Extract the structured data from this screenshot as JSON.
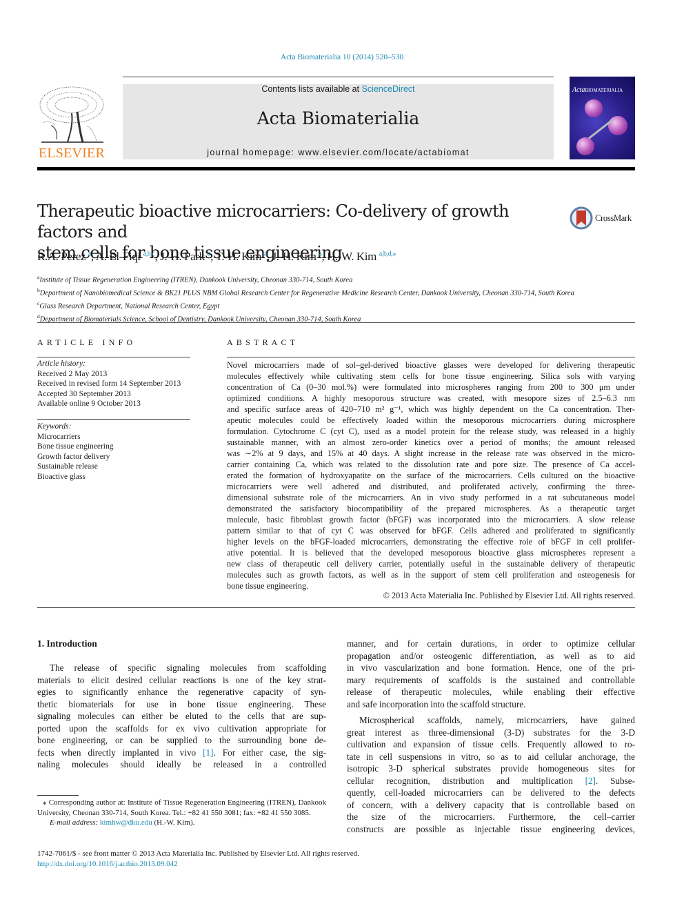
{
  "header": {
    "journal_reference": "Acta Biomaterialia 10 (2014) 520–530",
    "publisher_logo_text": "ELSEVIER",
    "contents_prefix": "Contents lists available at ",
    "contents_link": "ScienceDirect",
    "journal_title": "Acta Biomaterialia",
    "homepage_prefix": "journal homepage: ",
    "homepage_url": "www.elsevier.com/locate/actabiomat",
    "cover_title_italic": "Acta",
    "cover_title_caps": "BIOMATERIALIA"
  },
  "article": {
    "title_line_1": "Therapeutic bioactive microcarriers: Co-delivery of growth factors and",
    "title_line_2": "stem cells for bone tissue engineering",
    "crossmark_label": "CrossMark",
    "authors": [
      {
        "name": "R.A. Perez",
        "aff": "a"
      },
      {
        "name": "A. El-Fiqi",
        "aff": "a,b,c"
      },
      {
        "name": "J.-H. Park",
        "aff": "b"
      },
      {
        "name": "T.-H. Kim",
        "aff": "a"
      },
      {
        "name": "J.-H. Kim",
        "aff": "a"
      },
      {
        "name": "H.-W. Kim",
        "aff": "a,b,d,⁎"
      }
    ],
    "affiliations": [
      {
        "key": "a",
        "text": "Institute of Tissue Regeneration Engineering (ITREN), Dankook University, Cheonan 330-714, South Korea"
      },
      {
        "key": "b",
        "text": "Department of Nanobiomedical Science & BK21 PLUS NBM Global Research Center for Regenerative Medicine Research Center, Dankook University, Cheonan 330-714, South Korea"
      },
      {
        "key": "c",
        "text": "Glass Research Department, National Research Center, Egypt"
      },
      {
        "key": "d",
        "text": "Department of Biomaterials Science, School of Dentistry, Dankook University, Cheonan 330-714, South Korea"
      }
    ]
  },
  "article_info": {
    "heading": "ARTICLE INFO",
    "history_label": "Article history:",
    "history": [
      "Received 2 May 2013",
      "Received in revised form 14 September 2013",
      "Accepted 30 September 2013",
      "Available online 9 October 2013"
    ],
    "keywords_label": "Keywords:",
    "keywords": [
      "Microcarriers",
      "Bone tissue engineering",
      "Growth factor delivery",
      "Sustainable release",
      "Bioactive glass"
    ]
  },
  "abstract": {
    "heading": "ABSTRACT",
    "lines": [
      "Novel microcarriers made of sol–gel-derived bioactive glasses were developed for delivering therapeutic",
      "molecules effectively while cultivating stem cells for bone tissue engineering. Silica sols with varying",
      "concentration of Ca (0–30 mol.%) were formulated into microspheres ranging from 200 to 300 μm under",
      "optimized conditions. A highly mesoporous structure was created, with mesopore sizes of 2.5–6.3 nm",
      "and specific surface areas of 420–710 m² g⁻¹, which was highly dependent on the Ca concentration. Ther-",
      "apeutic molecules could be effectively loaded within the mesoporous microcarriers during microsphere",
      "formulation. Cytochrome C (cyt C), used as a model protein for the release study, was released in a highly",
      "sustainable manner, with an almost zero-order kinetics over a period of months; the amount released",
      "was ∼2% at 9 days, and 15% at 40 days. A slight increase in the release rate was observed in the micro-",
      "carrier containing Ca, which was related to the dissolution rate and pore size. The presence of Ca accel-",
      "erated the formation of hydroxyapatite on the surface of the microcarriers. Cells cultured on the bioactive",
      "microcarriers were well adhered and distributed, and proliferated actively, confirming the three-",
      "dimensional substrate role of the microcarriers. An in vivo study performed in a rat subcutaneous model",
      "demonstrated the satisfactory biocompatibility of the prepared microspheres. As a therapeutic target",
      "molecule, basic fibroblast growth factor (bFGF) was incorporated into the microcarriers. A slow release",
      "pattern similar to that of cyt C was observed for bFGF. Cells adhered and proliferated to significantly",
      "higher levels on the bFGF-loaded microcarriers, demonstrating the effective role of bFGF in cell prolifer-",
      "ative potential. It is believed that the developed mesoporous bioactive glass microspheres represent a",
      "new class of therapeutic cell delivery carrier, potentially useful in the sustainable delivery of therapeutic",
      "molecules such as growth factors, as well as in the support of stem cell proliferation and osteogenesis for",
      "bone tissue engineering."
    ],
    "copyright": "© 2013 Acta Materialia Inc. Published by Elsevier Ltd. All rights reserved."
  },
  "body": {
    "section_heading": "1. Introduction",
    "left_column": {
      "lines": [
        "The release of specific signaling molecules from scaffolding",
        "materials to elicit desired cellular reactions is one of the key strat-",
        "egies to significantly enhance the regenerative capacity of syn-",
        "thetic biomaterials for use in bone tissue engineering. These",
        "signaling molecules can either be eluted to the cells that are sup-",
        "ported upon the scaffolds for ex vivo cultivation appropriate for",
        "bone engineering, or can be supplied to the surrounding bone de-",
        "fects when directly implanted in vivo ",
        "naling molecules should ideally be released in a controlled"
      ],
      "citation_1": "[1]",
      "after_citation_1": ". For either case, the sig-"
    },
    "right_column": {
      "para1": [
        "manner, and for certain durations, in order to optimize cellular",
        "propagation and/or osteogenic differentiation, as well as to aid",
        "in vivo vascularization and bone formation. Hence, one of the pri-",
        "mary requirements of scaffolds is the sustained and controllable",
        "release of therapeutic molecules, while enabling their effective",
        "and safe incorporation into the scaffold structure."
      ],
      "para2": [
        "Microspherical scaffolds, namely, microcarriers, have gained",
        "great interest as three-dimensional (3-D) substrates for the 3-D",
        "cultivation and expansion of tissue cells. Frequently allowed to ro-",
        "tate in cell suspensions in vitro, so as to aid cellular anchorage, the",
        "isotropic 3-D spherical substrates provide homogeneous sites for",
        "cellular recognition, distribution and multiplication ",
        "quently, cell-loaded microcarriers can be delivered to the defects",
        "of concern, with a delivery capacity that is controllable based on",
        "the size of the microcarriers. Furthermore, the cell–carrier",
        "constructs are possible as injectable tissue engineering devices,"
      ],
      "citation_2": "[2]",
      "after_citation_2": ". Subse-"
    }
  },
  "footnote": {
    "star": "⁎",
    "corresponding": " Corresponding author at: Institute of Tissue Regeneration Engineering (ITREN), Dankook University, Cheonan 330-714, South Korea. Tel.: +82 41 550 3081; fax: +82 41 550 3085.",
    "email_label": "E-mail address:",
    "email": "kimhw@dku.edu",
    "email_suffix": " (H.-W. Kim)."
  },
  "footer": {
    "front_matter": "1742-7061/$ - see front matter © 2013 Acta Materialia Inc. Published by Elsevier Ltd. All rights reserved.",
    "doi": "http://dx.doi.org/10.1016/j.actbio.2013.09.042"
  },
  "colors": {
    "link": "#1e8bb3",
    "elsevier_orange": "#f07f1a",
    "masthead_gray": "#e6e6e6",
    "crossmark_red": "#c0392b"
  }
}
